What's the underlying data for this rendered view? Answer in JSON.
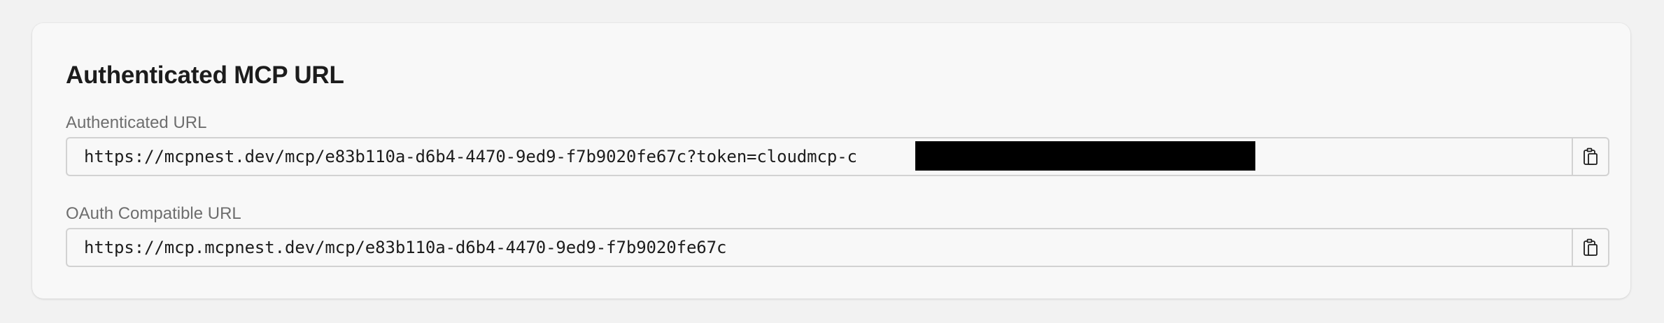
{
  "card": {
    "title": "Authenticated MCP URL"
  },
  "fields": [
    {
      "label": "Authenticated URL",
      "value": "https://mcpnest.dev/mcp/e83b110a-d6b4-4470-9ed9-f7b9020fe67c?token=cloudmcp-c",
      "redacted": true,
      "copy_icon": "clipboard-copy-icon"
    },
    {
      "label": "OAuth Compatible URL",
      "value": "https://mcp.mcpnest.dev/mcp/e83b110a-d6b4-4470-9ed9-f7b9020fe67c",
      "redacted": false,
      "copy_icon": "clipboard-copy-icon"
    }
  ],
  "colors": {
    "page_background": "#f2f2f2",
    "card_background": "#f8f8f8",
    "border": "#d2d2d2",
    "label_text": "#6e6e6e",
    "primary_text": "#1c1c1c",
    "redaction": "#000000"
  }
}
